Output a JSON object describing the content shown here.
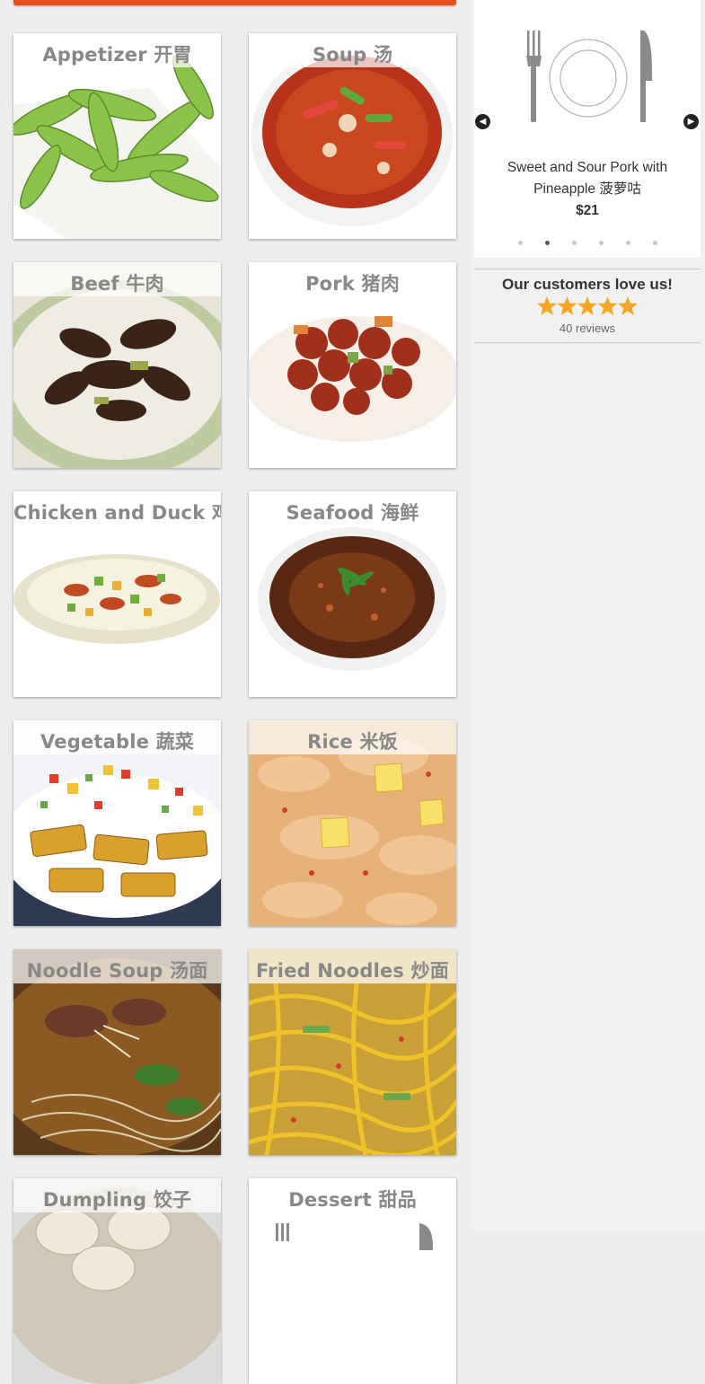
{
  "categories": [
    {
      "name": "Appetizer 开胃"
    },
    {
      "name": "Soup 汤"
    },
    {
      "name": "Beef 牛肉"
    },
    {
      "name": "Pork 猪肉"
    },
    {
      "name": "Chicken and Duck 鸡鸭"
    },
    {
      "name": "Seafood 海鲜"
    },
    {
      "name": "Vegetable 蔬菜"
    },
    {
      "name": "Rice 米饭"
    },
    {
      "name": "Noodle Soup 汤面"
    },
    {
      "name": "Fried Noodles 炒面"
    },
    {
      "name": "Dumpling 饺子"
    },
    {
      "name": "Dessert 甜品"
    }
  ],
  "slider": {
    "item_name": "Sweet and Sour Pork with Pineapple 菠萝咕",
    "item_price": "$21",
    "prev_icon": "chevron-left-icon",
    "next_icon": "chevron-right-icon",
    "placeholder_icon": "plate-utensils-icon",
    "dot_count": 6,
    "active_dot": 2
  },
  "reviews": {
    "heading": "Our customers love us!",
    "rating": 5,
    "count_text": "40 reviews"
  },
  "colors": {
    "accent": "#e8501f",
    "star": "#f5a623",
    "title_text": "#888888"
  }
}
